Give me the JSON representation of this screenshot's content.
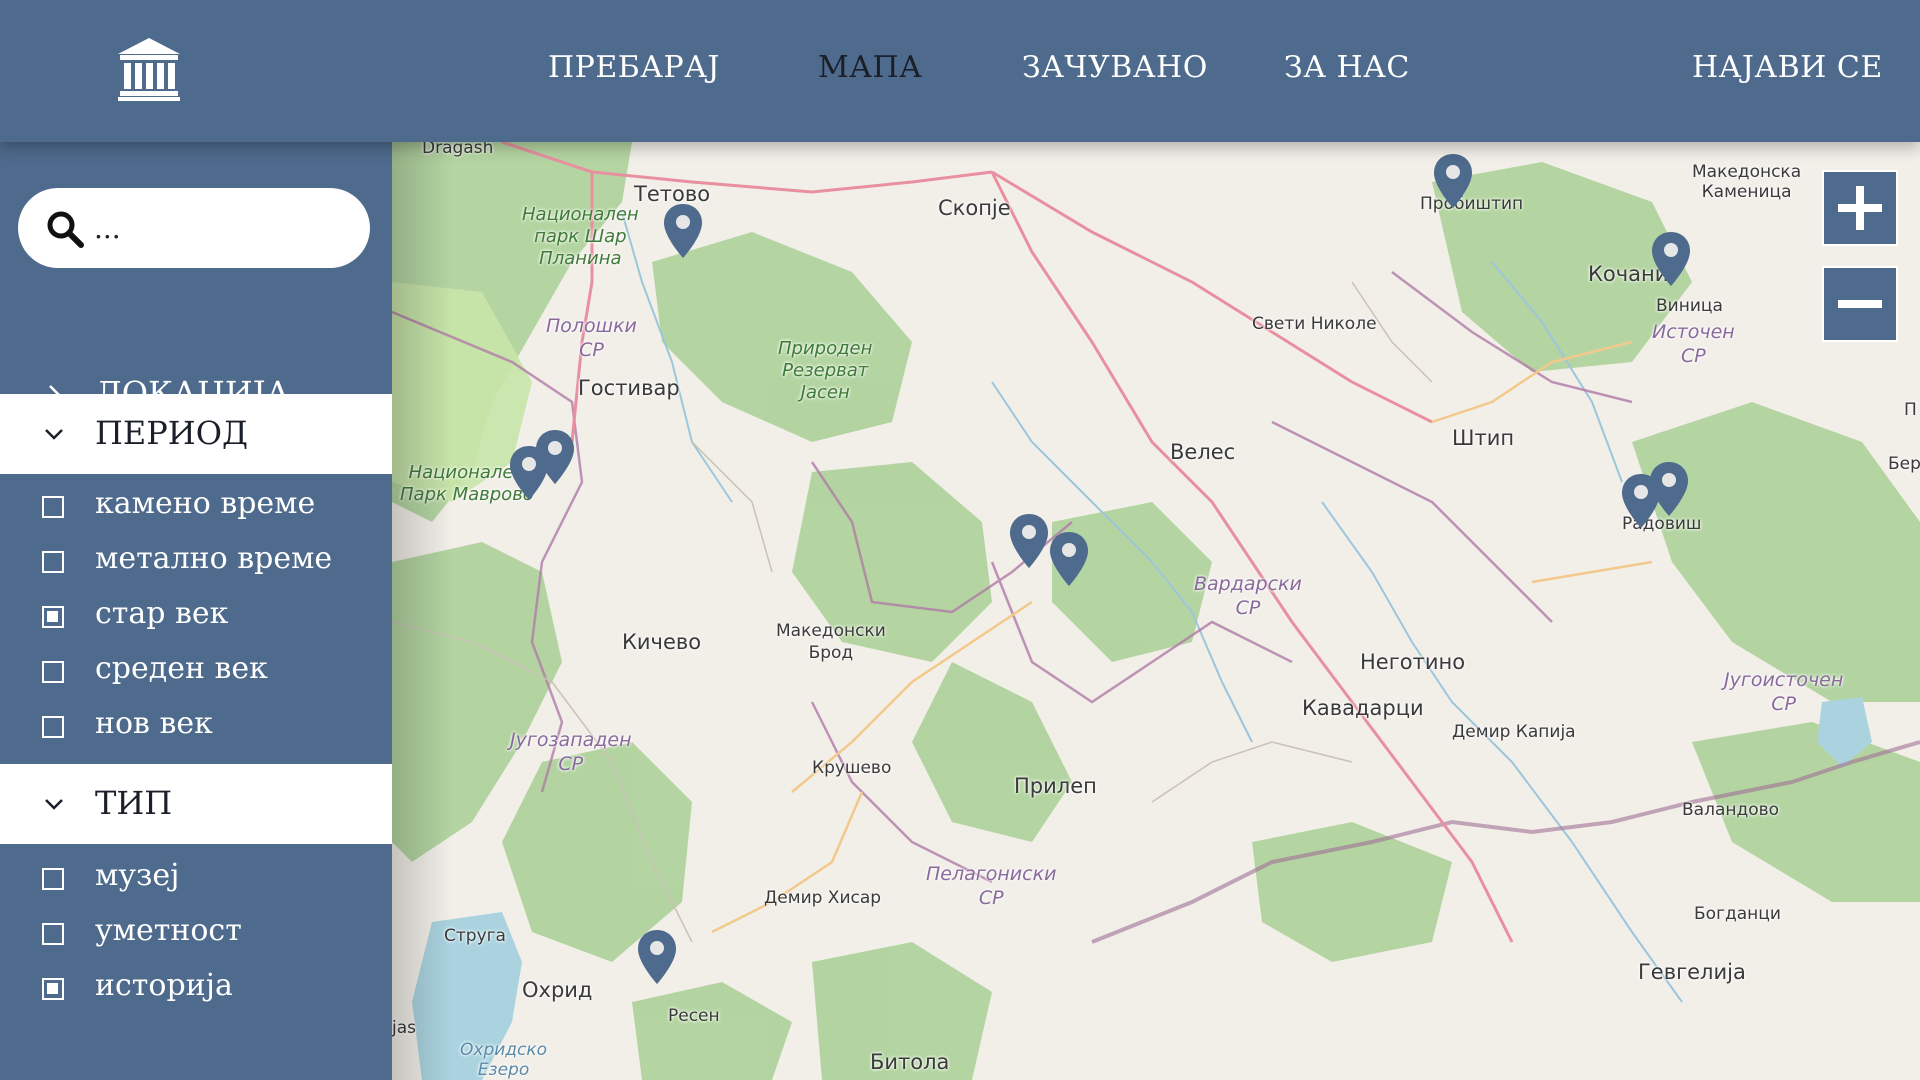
{
  "header": {
    "nav": [
      {
        "label": "ПРЕБАРАЈ",
        "active": false
      },
      {
        "label": "МАПА",
        "active": true
      },
      {
        "label": "ЗАЧУВАНО",
        "active": false
      },
      {
        "label": "ЗА НАС",
        "active": false
      }
    ],
    "login_label": "НАЈАВИ СЕ",
    "logo_icon": "museum-building-icon"
  },
  "sidebar": {
    "search": {
      "value": "",
      "placeholder": "..."
    },
    "location": {
      "label": "ЛОКАЦИЈА",
      "expanded": false
    },
    "period": {
      "label": "ПЕРИОД",
      "expanded": true,
      "options": [
        {
          "label": "камено време",
          "checked": false
        },
        {
          "label": "метално време",
          "checked": false
        },
        {
          "label": "стар век",
          "checked": true
        },
        {
          "label": "среден век",
          "checked": false
        },
        {
          "label": "нов век",
          "checked": false
        }
      ]
    },
    "type": {
      "label": "ТИП",
      "expanded": true,
      "options": [
        {
          "label": "музеј",
          "checked": false
        },
        {
          "label": "уметност",
          "checked": false
        },
        {
          "label": "историја",
          "checked": true
        }
      ]
    }
  },
  "map": {
    "zoom_in_label": "+",
    "zoom_out_label": "−",
    "places": {
      "dragash": "Dragash",
      "tetovo": "Тетово",
      "skopje": "Скопје",
      "probistip": "Пробиштип",
      "makedonska_kamenica": "Македонска\nКаменица",
      "kochani": "Кочани",
      "vinica": "Виница",
      "sveti_nikole": "Свети Николе",
      "gostivar": "Гостивар",
      "veles": "Велес",
      "shtip": "Штип",
      "radovish": "Радовиш",
      "kichevo": "Кичево",
      "makedonski_brod": "Македонски\nБрод",
      "negotino": "Неготино",
      "kavadarci": "Кавадарци",
      "demir_kapija": "Демир Капија",
      "krushevo": "Крушево",
      "prilep": "Прилеп",
      "valandovo": "Валандово",
      "demir_hisar": "Демир Хисар",
      "bogdanci": "Богданци",
      "struga": "Струга",
      "ohrid": "Охрид",
      "gevgelija": "Гевгелија",
      "resen": "Ресен",
      "bitola": "Битола",
      "ohridsko_ezero": "Охридско\nЕзеро",
      "jas": "jas",
      "ber": "Бер",
      "p_edge": "П"
    },
    "parks": {
      "shar": "Национален\nпарк Шар\nПланина",
      "jasen": "Природен\nРезерват\nЈасен",
      "mavrovo": "Национален\nПарк Маврово"
    },
    "regions": {
      "poloshki": "Полошки\nСР",
      "istochen": "Источен\nСР",
      "vardarski": "Вардарски\nСР",
      "jugozapaden": "Југозападен\nСР",
      "jugoistochen": "Југоисточен\nСР",
      "pelagoniski": "Пелагониски\nСР"
    },
    "marker_icon": "map-pin-icon",
    "markers_count": 10
  },
  "colors": {
    "primary": "#4e6a8c",
    "nav_active": "#1a1f2a",
    "map_land": "#f2efe9",
    "forest": "#9fcb8a",
    "water": "#aad3df",
    "border_line": "#b07aa8",
    "motorway": "#e8909f"
  }
}
